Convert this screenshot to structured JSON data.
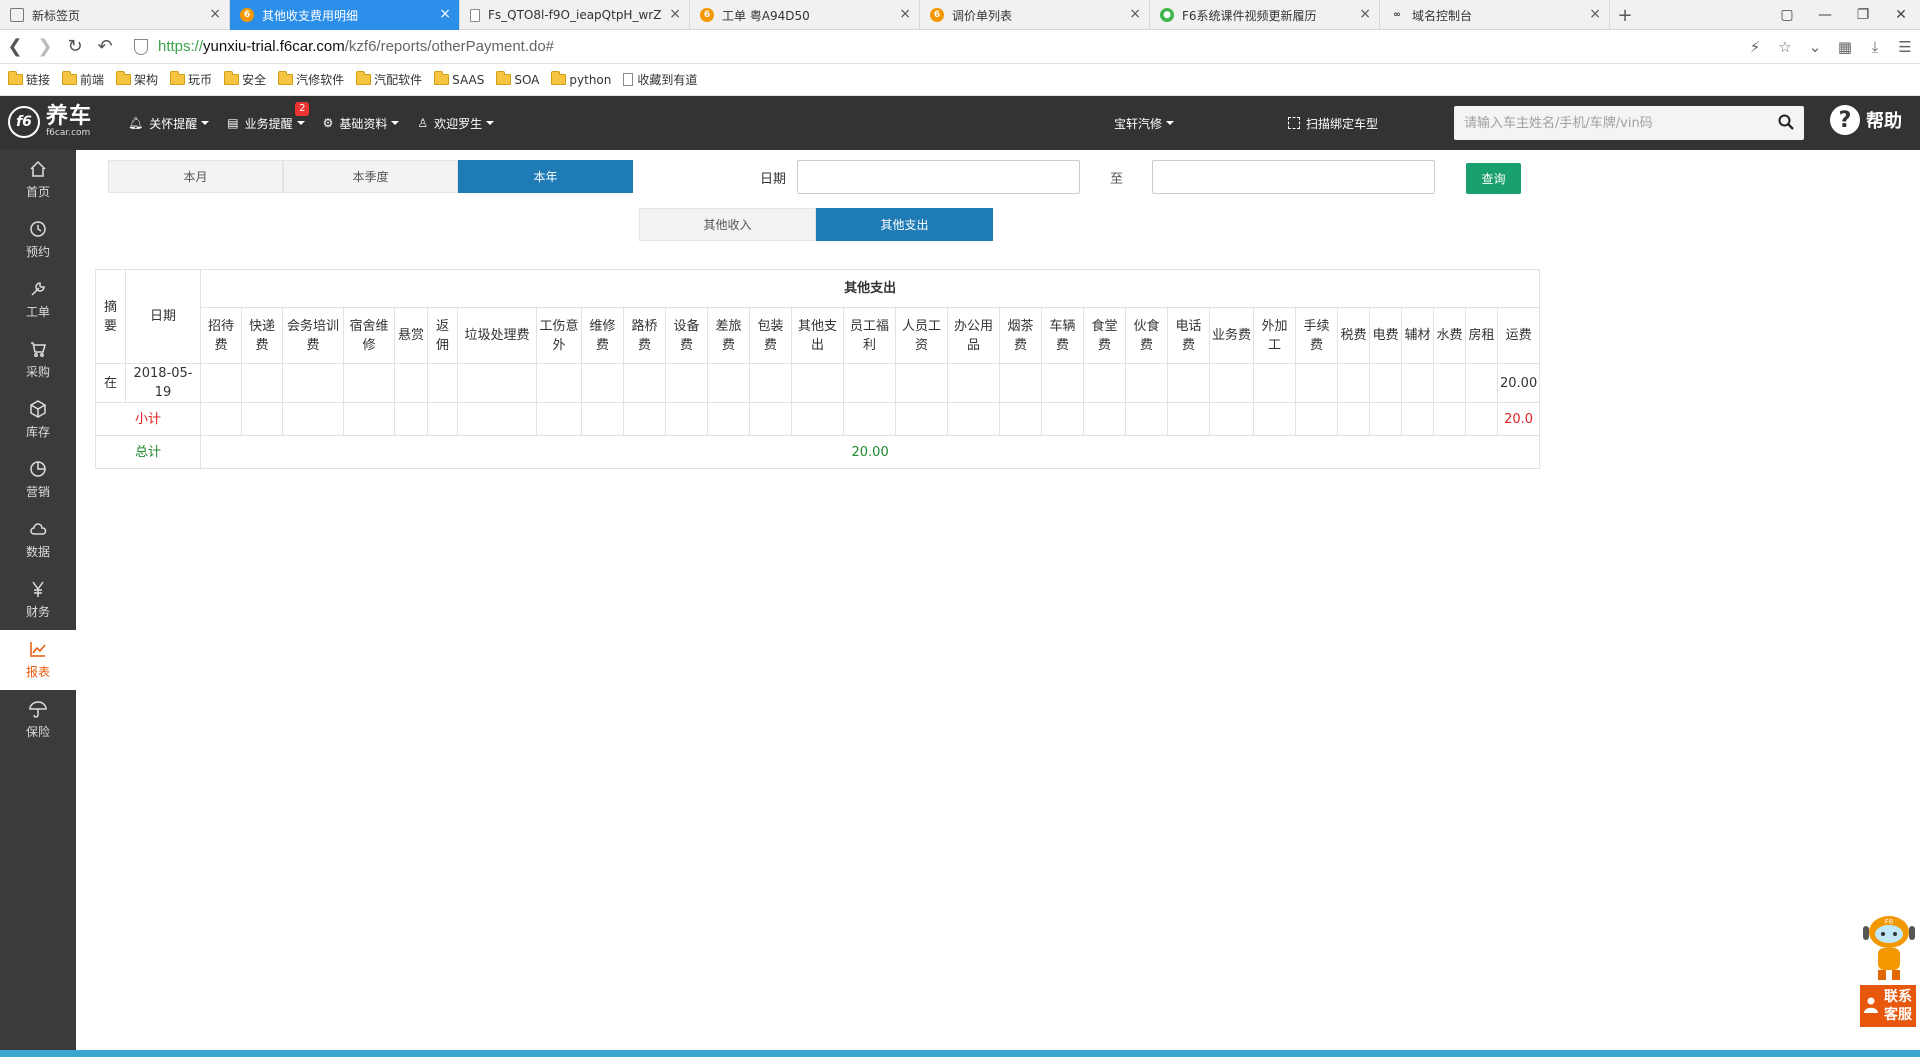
{
  "browser": {
    "tabs": [
      {
        "title": "新标签页",
        "favicon": "grid-icon",
        "active": false
      },
      {
        "title": "其他收支费用明细",
        "favicon": "f6-icon",
        "active": true
      },
      {
        "title": "Fs_QTO8l-f9O_ieapQtpH_wrZ",
        "favicon": "document-icon",
        "active": false
      },
      {
        "title": "工单 粤A94D50",
        "favicon": "f6-icon",
        "active": false
      },
      {
        "title": "调价单列表",
        "favicon": "f6-icon",
        "active": false
      },
      {
        "title": "F6系统课件视频更新履历",
        "favicon": "wechat-icon",
        "active": false
      },
      {
        "title": "域名控制台",
        "favicon": "link-icon",
        "active": false
      }
    ],
    "url": {
      "scheme": "https://",
      "host": "yunxiu-trial.f6car.com",
      "path": "/kzf6/reports/otherPayment.do#"
    },
    "bookmarks": [
      {
        "label": "链接",
        "type": "folder"
      },
      {
        "label": "前端",
        "type": "folder"
      },
      {
        "label": "架构",
        "type": "folder"
      },
      {
        "label": "玩币",
        "type": "folder"
      },
      {
        "label": "安全",
        "type": "folder"
      },
      {
        "label": "汽修软件",
        "type": "folder"
      },
      {
        "label": "汽配软件",
        "type": "folder"
      },
      {
        "label": "SAAS",
        "type": "folder"
      },
      {
        "label": "SOA",
        "type": "folder"
      },
      {
        "label": "python",
        "type": "folder"
      },
      {
        "label": "收藏到有道",
        "type": "page"
      }
    ]
  },
  "header": {
    "logo_mark": "f6",
    "logo_name": "养车",
    "logo_domain": "f6car.com",
    "nav": [
      {
        "label": "关怀提醒",
        "icon": "bell-icon"
      },
      {
        "label": "业务提醒",
        "icon": "clipboard-icon",
        "badge": "2"
      },
      {
        "label": "基础资料",
        "icon": "gear-icon"
      },
      {
        "label": "欢迎罗生",
        "icon": "user-icon"
      }
    ],
    "shop": "宝轩汽修",
    "scan_bind": "扫描绑定车型",
    "search_placeholder": "请输入车主姓名/手机/车牌/vin码",
    "help": "帮助"
  },
  "sidebar": [
    {
      "label": "首页",
      "icon": "home-icon",
      "active": false
    },
    {
      "label": "预约",
      "icon": "clock-icon",
      "active": false
    },
    {
      "label": "工单",
      "icon": "wrench-icon",
      "active": false
    },
    {
      "label": "采购",
      "icon": "cart-icon",
      "active": false
    },
    {
      "label": "库存",
      "icon": "box-icon",
      "active": false
    },
    {
      "label": "营销",
      "icon": "pie-icon",
      "active": false
    },
    {
      "label": "数据",
      "icon": "cloud-icon",
      "active": false
    },
    {
      "label": "财务",
      "icon": "yen-icon",
      "active": false
    },
    {
      "label": "报表",
      "icon": "chart-icon",
      "active": true
    },
    {
      "label": "保险",
      "icon": "umbrella-icon",
      "active": false
    }
  ],
  "filters": {
    "period_tabs": [
      {
        "label": "本月",
        "active": false
      },
      {
        "label": "本季度",
        "active": false
      },
      {
        "label": "本年",
        "active": true
      }
    ],
    "date_label": "日期",
    "date_from": "",
    "to_label": "至",
    "date_to": "",
    "query_button": "查询",
    "type_tabs": [
      {
        "label": "其他收入",
        "active": false
      },
      {
        "label": "其他支出",
        "active": true
      }
    ]
  },
  "report": {
    "col_summary": "摘要",
    "col_date": "日期",
    "group_header": "其他支出",
    "expense_columns": [
      "招待费",
      "快递费",
      "会务培训费",
      "宿舍维修",
      "悬赏",
      "返佣",
      "垃圾处理费",
      "工伤意外",
      "维修费",
      "路桥费",
      "设备费",
      "差旅费",
      "包装费",
      "其他支出",
      "员工福利",
      "人员工资",
      "办公用品",
      "烟茶费",
      "车辆费",
      "食堂费",
      "伙食费",
      "电话费",
      "业务费",
      "外加工",
      "手续费",
      "税费",
      "电费",
      "辅材",
      "水费",
      "房租",
      "运费"
    ],
    "rows": [
      {
        "summary": "在",
        "date": "2018-05-19",
        "values": {
          "运费": "20.00"
        }
      }
    ],
    "subtotal": {
      "label": "小计",
      "values": {
        "运费": "20.0"
      }
    },
    "total": {
      "label": "总计",
      "value": "20.00"
    }
  },
  "floating_service": {
    "label_line1": "联系",
    "label_line2": "客服",
    "robot_text": "F6"
  }
}
